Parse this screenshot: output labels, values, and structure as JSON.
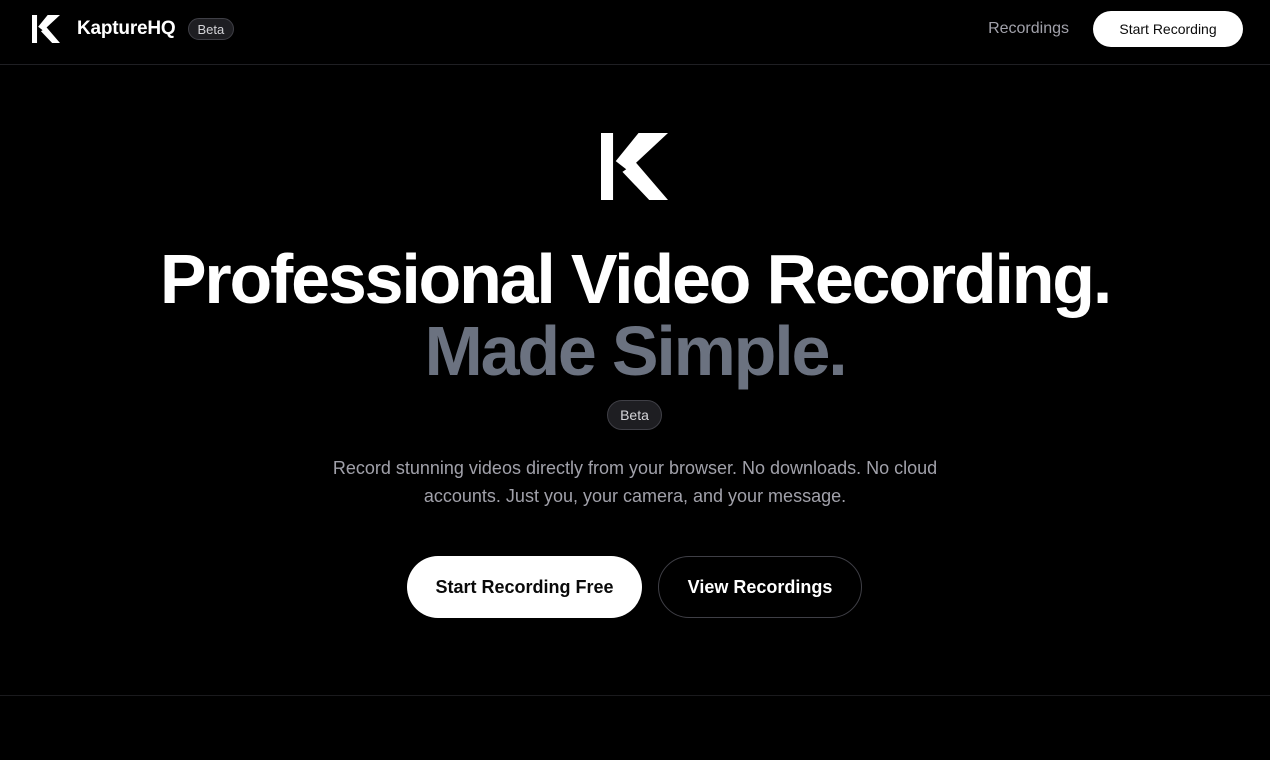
{
  "navbar": {
    "brand_name": "KaptureHQ",
    "brand_badge": "Beta",
    "links": [
      {
        "label": "Recordings"
      }
    ],
    "cta_label": "Start Recording"
  },
  "hero": {
    "logo_icon": "k-logo-icon",
    "headline_line1": "Professional Video Recording.",
    "headline_line2": "Made Simple.",
    "badge": "Beta",
    "subtitle": "Record stunning videos directly from your browser. No downloads. No cloud accounts. Just you, your camera, and your message.",
    "primary_button": "Start Recording Free",
    "secondary_button": "View Recordings"
  },
  "colors": {
    "background": "#000000",
    "text_primary": "#ffffff",
    "text_muted": "#a1a1aa",
    "headline_secondary": "#6b7280",
    "button_primary_bg": "#ffffff"
  }
}
